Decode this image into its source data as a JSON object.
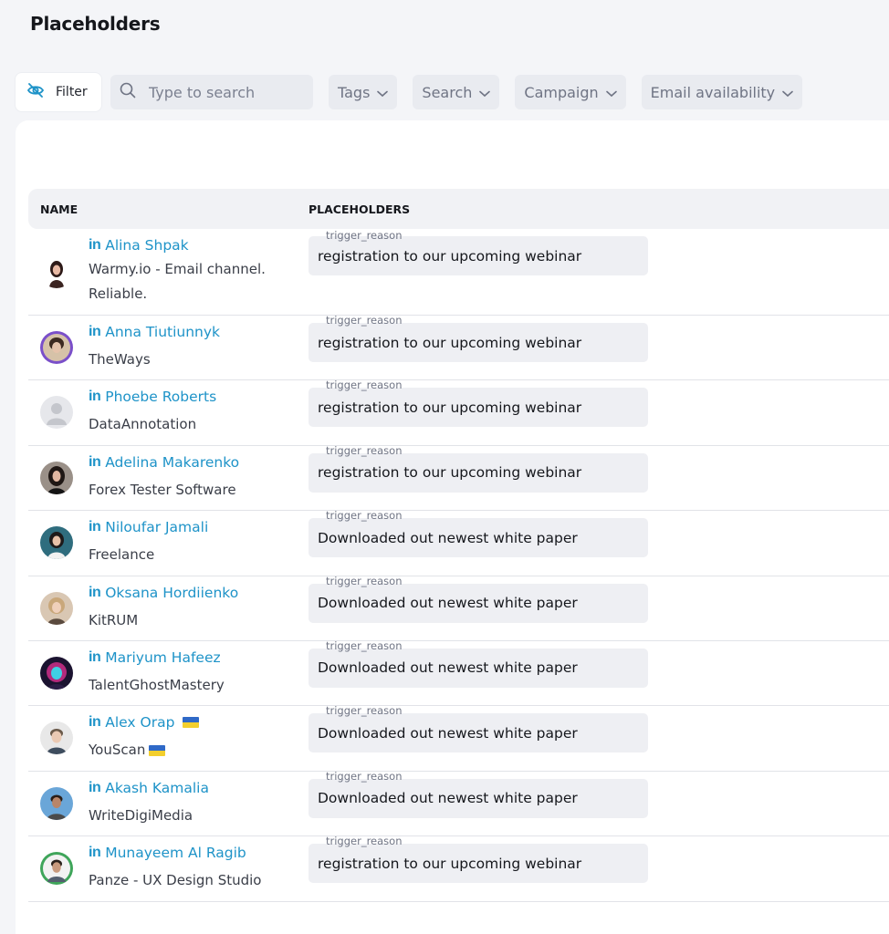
{
  "page": {
    "title": "Placeholders"
  },
  "toolbar": {
    "filter_label": "Filter",
    "search_placeholder": "Type to search",
    "dropdowns": [
      "Tags",
      "Search",
      "Campaign",
      "Email availability"
    ]
  },
  "table": {
    "columns": {
      "name": "NAME",
      "placeholders": "PLACEHOLDERS"
    },
    "rows": [
      {
        "name": "Alina Shpak",
        "company": "Warmy.io - Email channel. Reliable.",
        "placeholder_key": "trigger_reason",
        "placeholder_value": "registration to our upcoming webinar"
      },
      {
        "name": "Anna Tiutiunnyk",
        "company": "TheWays",
        "placeholder_key": "trigger_reason",
        "placeholder_value": "registration to our upcoming webinar"
      },
      {
        "name": "Phoebe Roberts",
        "company": "DataAnnotation",
        "placeholder_key": "trigger_reason",
        "placeholder_value": "registration to our upcoming webinar"
      },
      {
        "name": "Adelina Makarenko",
        "company": "Forex Tester Software",
        "placeholder_key": "trigger_reason",
        "placeholder_value": "registration to our upcoming webinar"
      },
      {
        "name": "Niloufar Jamali",
        "company": "Freelance",
        "placeholder_key": "trigger_reason",
        "placeholder_value": "Downloaded out newest white paper"
      },
      {
        "name": "Oksana Hordiienko",
        "company": "KitRUM",
        "placeholder_key": "trigger_reason",
        "placeholder_value": "Downloaded out newest white paper"
      },
      {
        "name": "Mariyum Hafeez",
        "company": "TalentGhostMastery",
        "placeholder_key": "trigger_reason",
        "placeholder_value": "Downloaded out newest white paper"
      },
      {
        "name": "Alex Orap",
        "company": "YouScan",
        "placeholder_key": "trigger_reason",
        "placeholder_value": "Downloaded out newest white paper"
      },
      {
        "name": "Akash Kamalia",
        "company": "WriteDigiMedia",
        "placeholder_key": "trigger_reason",
        "placeholder_value": "Downloaded out newest white paper"
      },
      {
        "name": "Munayeem Al Ragib",
        "company": "Panze - UX Design Studio",
        "placeholder_key": "trigger_reason",
        "placeholder_value": "registration to our upcoming webinar"
      }
    ]
  },
  "icons": {
    "filter": "eye-off-icon",
    "search": "search-icon",
    "dropdown": "chevron-down-icon",
    "linkedin": "linkedin-icon",
    "flag": "ukraine-flag-icon"
  },
  "colors": {
    "link": "#1e93c8",
    "background": "#f4f5f8",
    "placeholder_box": "#eeeff3"
  }
}
